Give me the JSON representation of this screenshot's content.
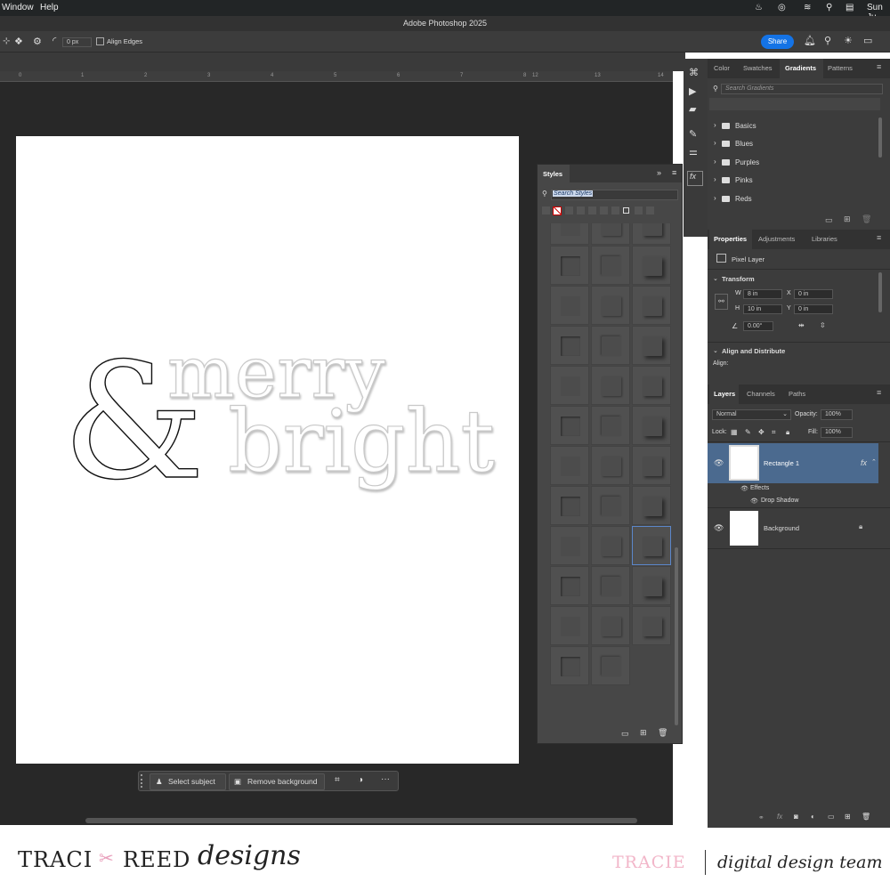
{
  "menubar": {
    "items": [
      "Window",
      "Help"
    ],
    "clock": "Sun Ju"
  },
  "window": {
    "title": "Adobe Photoshop 2025"
  },
  "options": {
    "feather_value": "0 px",
    "align_edges_label": "Align Edges",
    "share_label": "Share"
  },
  "ruler": {
    "ticks": [
      "0",
      "1",
      "2",
      "3",
      "4",
      "5",
      "6",
      "7",
      "8",
      "12",
      "13",
      "14"
    ]
  },
  "artwork": {
    "ampersand": "&",
    "word1": "merry",
    "word2": "bright"
  },
  "context_bar": {
    "select_subject": "Select subject",
    "remove_background": "Remove background",
    "more": "···"
  },
  "styles_panel": {
    "title": "Styles",
    "search_placeholder": "Search Styles"
  },
  "gradients_panel": {
    "tabs": [
      "Color",
      "Swatches",
      "Gradients",
      "Patterns"
    ],
    "active_tab": "Gradients",
    "search_placeholder": "Search Gradients",
    "folders": [
      "Basics",
      "Blues",
      "Purples",
      "Pinks",
      "Reds"
    ]
  },
  "properties_panel": {
    "tabs": [
      "Properties",
      "Adjustments",
      "Libraries"
    ],
    "layer_type": "Pixel Layer",
    "transform_label": "Transform",
    "w_label": "W",
    "w": "8 in",
    "x_label": "X",
    "x": "0 in",
    "h_label": "H",
    "h": "10 in",
    "y_label": "Y",
    "y": "0 in",
    "angle": "0.00°",
    "align_section": "Align and Distribute",
    "align_label": "Align:"
  },
  "layers_panel": {
    "tabs": [
      "Layers",
      "Channels",
      "Paths"
    ],
    "blend_mode": "Normal",
    "opacity_label": "Opacity:",
    "opacity": "100%",
    "lock_label": "Lock:",
    "fill_label": "Fill:",
    "fill": "100%",
    "layers": [
      {
        "name": "Rectangle 1",
        "fx": "fx",
        "effects_label": "Effects",
        "effect": "Drop Shadow"
      },
      {
        "name": "Background"
      }
    ]
  },
  "footer": {
    "brand_left": "TRACI",
    "brand_right": "REED",
    "brand_script": "designs",
    "member": "TRACIE",
    "team": "digital design team"
  },
  "colors": {
    "accent": "#1473e6",
    "selected_layer": "#4b6a8f",
    "member_pink": "#f2b6c9"
  }
}
